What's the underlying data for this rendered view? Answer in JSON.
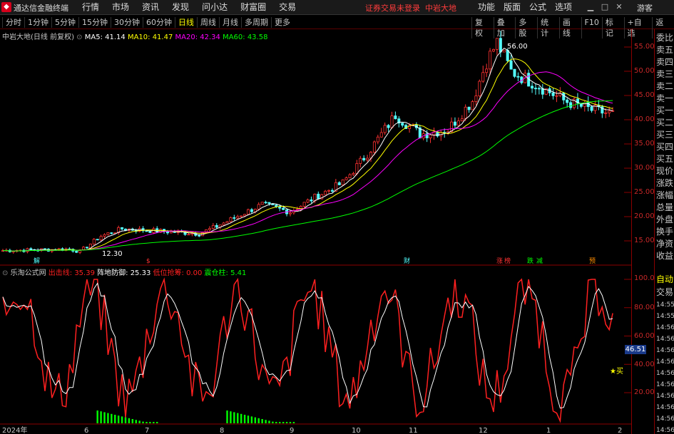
{
  "app": {
    "name": "通达信金融终端",
    "login_notice": "证券交易未登录",
    "stock": "中岩大地",
    "guest": "游客"
  },
  "top_menu": [
    "行情",
    "市场",
    "资讯",
    "发现",
    "问小达",
    "财富圈",
    "交易"
  ],
  "right_menu": [
    "功能",
    "版面",
    "公式",
    "选项"
  ],
  "periods": [
    "分时",
    "1分钟",
    "5分钟",
    "15分钟",
    "30分钟",
    "60分钟",
    "日线",
    "周线",
    "月线",
    "多周期",
    "更多"
  ],
  "active_period": "日线",
  "tools": [
    "复权",
    "叠加",
    "多股",
    "统计",
    "画线",
    "F10",
    "标记",
    "+自选",
    "返回"
  ],
  "main_legend": {
    "title": "中岩大地(日线 前复权)",
    "ma5": "MA5: 41.14",
    "ma10": "MA10: 41.47",
    "ma20": "MA20: 42.34",
    "ma60": "MA60: 43.58"
  },
  "sub_legend": {
    "name": "乐淘公式网",
    "l1": "出击线: 35.39",
    "l2": "阵地防御: 25.33",
    "l3": "低位抢筹: 0.00",
    "l4": "震仓柱: 5.41"
  },
  "price_ticks": [
    "55.00",
    "50.00",
    "45.00",
    "40.00",
    "35.00",
    "30.00",
    "25.00",
    "20.00",
    "15.00"
  ],
  "osc_ticks": [
    "100.0",
    "80.00",
    "60.00",
    "40.00",
    "20.00"
  ],
  "osc_value": "46.51",
  "side_panel": [
    "委比",
    "卖五",
    "卖四",
    "卖三",
    "卖二",
    "卖一",
    "买一",
    "买二",
    "买三",
    "买四",
    "买五",
    "现价",
    "涨跌",
    "涨幅",
    "总量",
    "外盘",
    "换手",
    "净资",
    "收益",
    "自动",
    "交易",
    "14:55",
    "14:55",
    "14:56",
    "14:56",
    "14:56",
    "14:56",
    "14:56",
    "14:56",
    "14:56",
    "14:56",
    "14:56",
    "14:56"
  ],
  "x_labels": [
    "2024年",
    "6",
    "7",
    "8",
    "9",
    "10",
    "11",
    "12",
    "1",
    "2"
  ],
  "annotations": {
    "high": "56.00",
    "low": "12.30",
    "buy": "买"
  },
  "events": [
    "解",
    "$",
    "财",
    "涨",
    "榜",
    "跌",
    "减",
    "预"
  ],
  "colors": {
    "up": "#ff3232",
    "down": "#54ffff",
    "ma5": "#ffffff",
    "ma10": "#ffff00",
    "ma20": "#ff00ff",
    "ma60": "#00ff00",
    "osc": "#ff2020"
  }
}
